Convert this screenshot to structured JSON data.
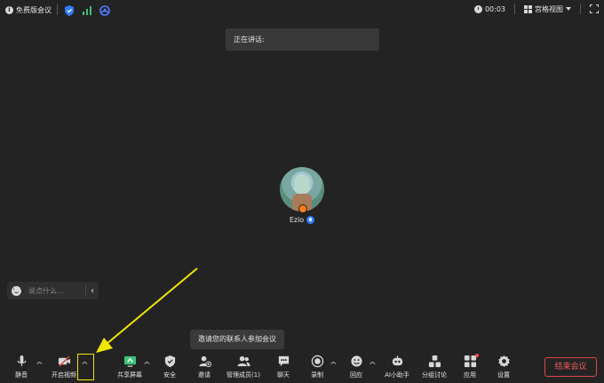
{
  "topbar": {
    "free_label": "免费版会议",
    "timer": "00:03",
    "view_label": "宫格视图",
    "icons": [
      "info-icon",
      "shield-icon",
      "signal-icon",
      "network-icon",
      "clock-icon",
      "grid-view-icon",
      "chevron-down-icon",
      "fullscreen-icon"
    ]
  },
  "speaking": {
    "label": "正在讲话:"
  },
  "participant": {
    "name": "Ezio"
  },
  "chat": {
    "placeholder": "说点什么..."
  },
  "tooltip": {
    "text": "邀请您的联系人参加会议"
  },
  "toolbar": {
    "mute": "静音",
    "video": "开启视频",
    "share": "共享屏幕",
    "security": "安全",
    "invite": "邀请",
    "members": "管理成员(1)",
    "chat": "聊天",
    "record": "录制",
    "reaction": "回应",
    "ai": "AI小助手",
    "breakout": "分组讨论",
    "apps": "应用",
    "settings": "设置",
    "end": "结束会议"
  },
  "colors": {
    "background": "#232323",
    "accent_blue": "#2f7dff",
    "end_red": "#e04545",
    "annotation_yellow": "#f2e600",
    "signal_green": "#3ec27a"
  }
}
